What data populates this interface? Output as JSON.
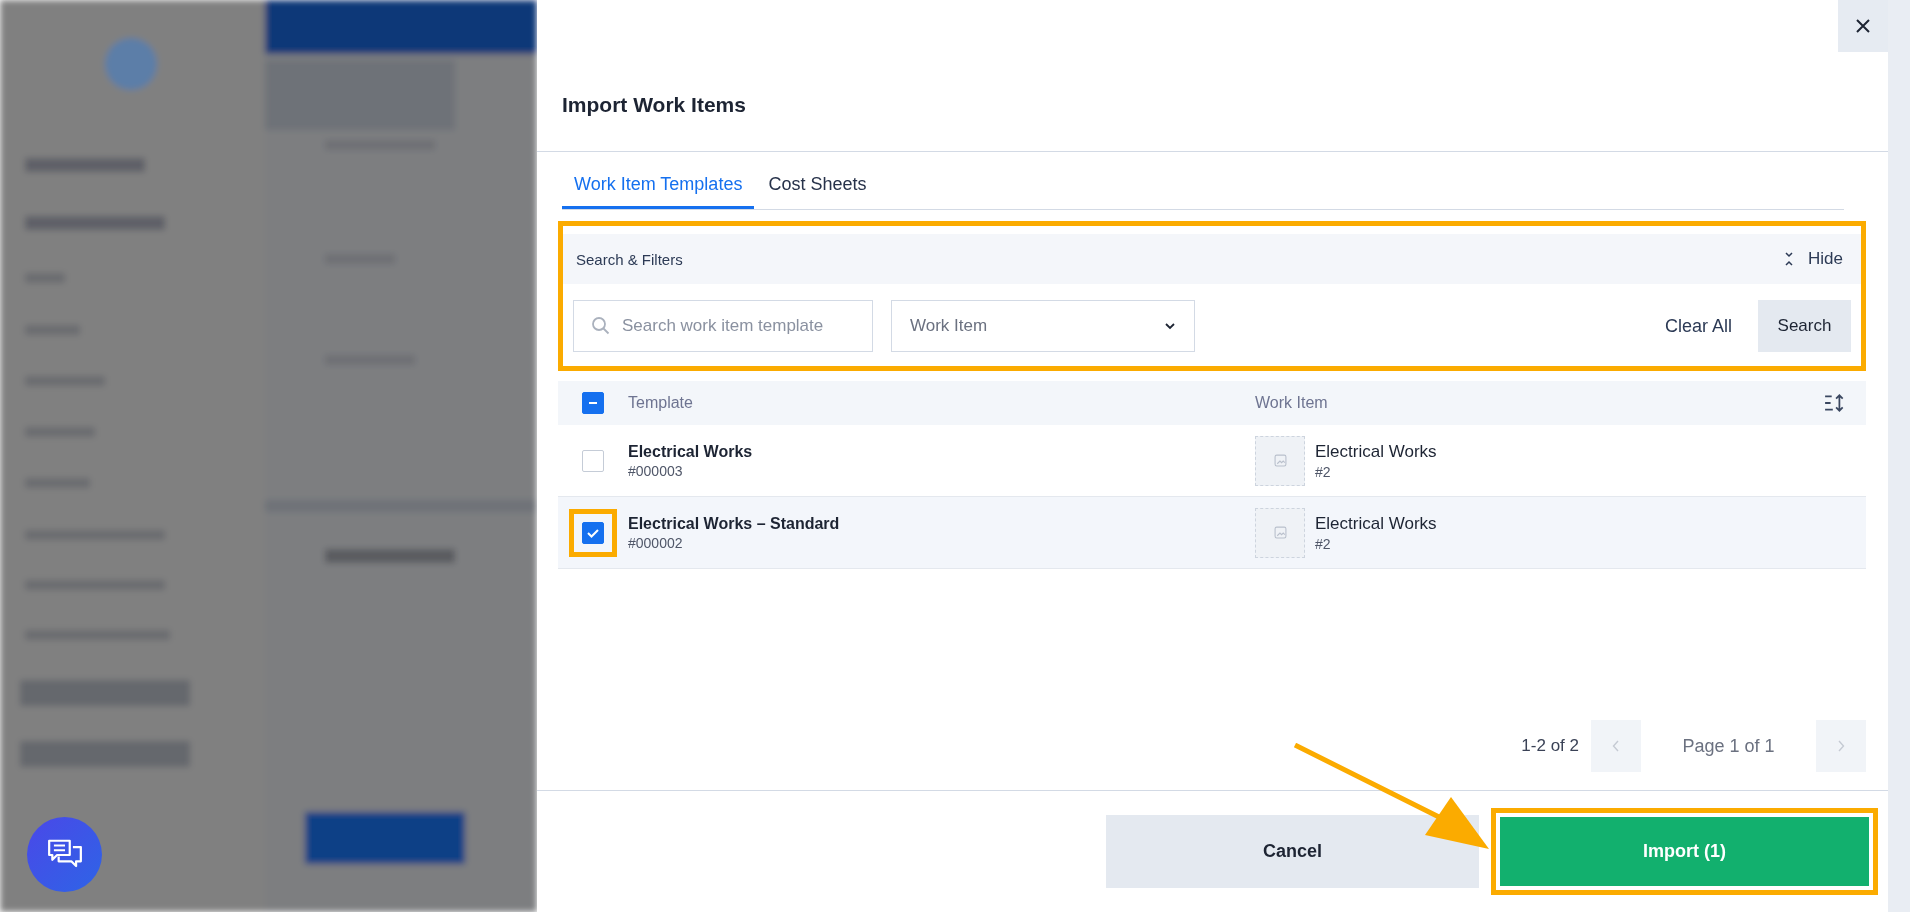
{
  "dialog": {
    "title": "Import Work Items",
    "tabs": [
      {
        "label": "Work Item Templates",
        "selected": true
      },
      {
        "label": "Cost Sheets",
        "selected": false
      }
    ],
    "filters": {
      "title": "Search & Filters",
      "toggle": "Hide",
      "highlighted": true,
      "search": {
        "placeholder": "Search work item template"
      },
      "dropdown": {
        "value": "Work Item"
      },
      "clear": "Clear All",
      "submit": "Search"
    },
    "table": {
      "select_all": {
        "checked": false,
        "indeterminate": true
      },
      "columns": [
        "Template",
        "Work Item"
      ],
      "rows": [
        {
          "name": "Electrical Works",
          "code": "#000003",
          "item_name": "Electrical Works",
          "item_code": "#2",
          "selected": false,
          "highlighted": false
        },
        {
          "name": "Electrical Works – Standard",
          "code": "#000002",
          "item_name": "Electrical Works",
          "item_code": "#2",
          "selected": true,
          "highlighted": true
        }
      ]
    },
    "pagination": {
      "range": "1-2 of 2",
      "page": "Page 1 of 1",
      "prev_disabled": true,
      "next_disabled": true
    },
    "footer": {
      "cancel": "Cancel",
      "import": {
        "label": "Import (1)",
        "highlighted": true,
        "arrow": true
      }
    }
  }
}
